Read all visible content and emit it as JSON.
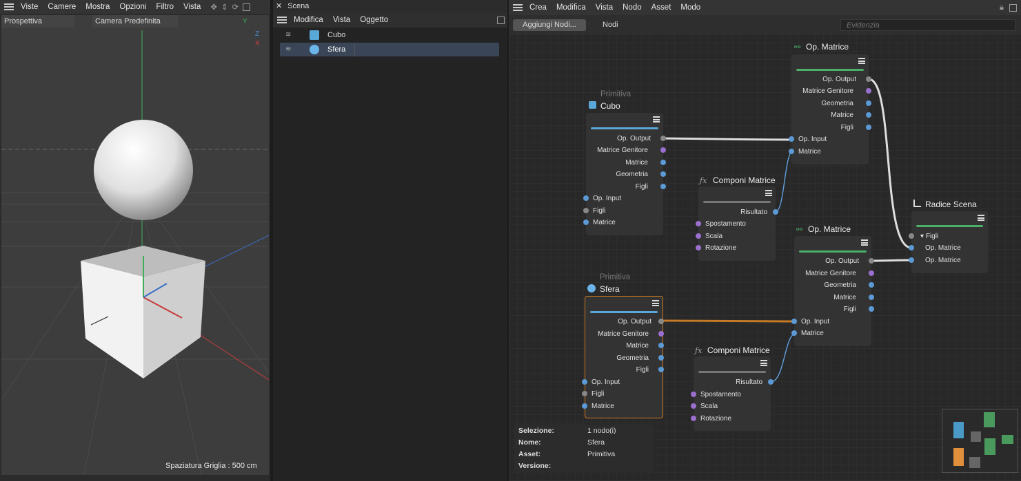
{
  "viewport": {
    "menu": [
      "Viste",
      "Camere",
      "Mostra",
      "Opzioni",
      "Filtro",
      "Vista"
    ],
    "view_mode": "Prospettiva",
    "camera": "Camera Predefinita",
    "axes": {
      "y": "Y",
      "z": "Z",
      "x": "X"
    },
    "grid_spacing": "Spaziatura Griglia : 500 cm"
  },
  "scene": {
    "title": "Scena",
    "menu": [
      "Modifica",
      "Vista",
      "Oggetto"
    ],
    "objects": [
      {
        "label": "Cubo"
      },
      {
        "label": "Sfera"
      }
    ]
  },
  "editor": {
    "menu": [
      "Crea",
      "Modifica",
      "Vista",
      "Nodo",
      "Asset",
      "Modo"
    ],
    "add_nodes": "Aggiungi Nodi...",
    "nodes_tab": "Nodi",
    "search_placeholder": "Evidenzia",
    "nodes": {
      "cubo": {
        "subtitle": "Primitiva",
        "title": "Cubo",
        "outputs": [
          "Op. Output",
          "Matrice Genitore",
          "Matrice",
          "Geometria",
          "Figli"
        ],
        "inputs": [
          "Op. Input",
          "Figli",
          "Matrice"
        ]
      },
      "sfera": {
        "subtitle": "Primitiva",
        "title": "Sfera",
        "outputs": [
          "Op. Output",
          "Matrice Genitore",
          "Matrice",
          "Geometria",
          "Figli"
        ],
        "inputs": [
          "Op. Input",
          "Figli",
          "Matrice"
        ]
      },
      "opm1": {
        "title": "Op. Matrice",
        "outputs": [
          "Op. Output",
          "Matrice Genitore",
          "Geometria",
          "Matrice",
          "Figli"
        ],
        "inputs": [
          "Op. Input",
          "Matrice"
        ]
      },
      "opm2": {
        "title": "Op. Matrice",
        "outputs": [
          "Op. Output",
          "Matrice Genitore",
          "Geometria",
          "Matrice",
          "Figli"
        ],
        "inputs": [
          "Op. Input",
          "Matrice"
        ]
      },
      "cm1": {
        "title": "Componi Matrice",
        "outputs": [
          "Risultato"
        ],
        "inputs": [
          "Spostamento",
          "Scala",
          "Rotazione"
        ]
      },
      "cm2": {
        "title": "Componi Matrice",
        "outputs": [
          "Risultato"
        ],
        "inputs": [
          "Spostamento",
          "Scala",
          "Rotazione"
        ]
      },
      "root": {
        "title": "Radice Scena",
        "inputs": [
          "Figli",
          "Op. Matrice",
          "Op. Matrice"
        ]
      }
    },
    "info": {
      "rows": [
        {
          "k": "Selezione:",
          "v": "1 nodo(i)"
        },
        {
          "k": "Nome:",
          "v": "Sfera"
        },
        {
          "k": "Asset:",
          "v": "Primitiva"
        },
        {
          "k": "Versione:",
          "v": ""
        }
      ]
    }
  },
  "colors": {
    "accent_blue": "#5aa8d8",
    "accent_green": "#4caf6a",
    "selection_orange": "#d07a22",
    "sphere_icon": "#6bb5ea"
  }
}
